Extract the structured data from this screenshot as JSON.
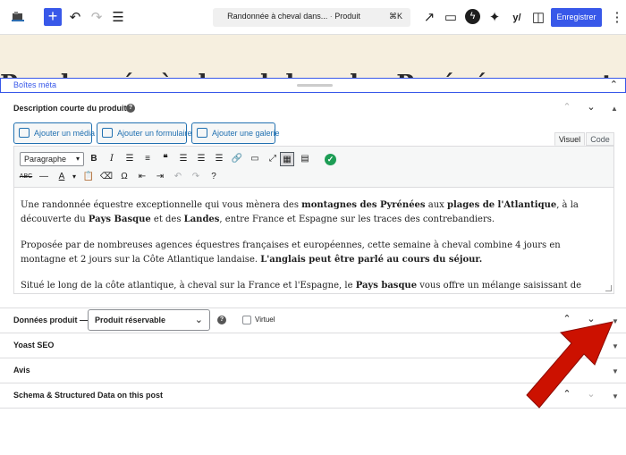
{
  "topbar": {
    "document_title": "Randonnée à cheval dans...",
    "document_separator": "·",
    "document_type": "Produit",
    "shortcut": "⌘K",
    "save_label": "Enregistrer"
  },
  "canvas": {
    "title_partial": "Randonnée à cheval dans les Pyrénées : montagne et la Pyrénées"
  },
  "meta_box": {
    "title": "Boîtes méta"
  },
  "short_description": {
    "title": "Description courte du produit",
    "buttons": {
      "add_media": "Ajouter un média",
      "add_form": "Ajouter un formulaire",
      "add_gallery": "Ajouter une galerie"
    },
    "tabs": {
      "visual": "Visuel",
      "code": "Code"
    },
    "format_select": "Paragraphe",
    "content": {
      "p1_a": "Une randonnée équestre exceptionnelle qui vous mènera des ",
      "p1_b": "montagnes des Pyrénées",
      "p1_c": " aux ",
      "p1_d": "plages de l'Atlantique",
      "p1_e": ", à la découverte du ",
      "p1_f": "Pays Basque",
      "p1_g": " et des ",
      "p1_h": "Landes",
      "p1_i": ", entre France et Espagne sur les traces des contrebandiers.",
      "p2_a": "Proposée par de nombreuses agences équestres françaises et européennes, cette semaine à cheval combine 4 jours en montagne et 2 jours sur la Côte Atlantique landaise. ",
      "p2_b": "L'anglais peut être parlé au cours du séjour.",
      "p3_a": "Situé le long de la côte atlantique, à cheval sur la France et l'Espagne, le ",
      "p3_b": "Pays basque",
      "p3_c": " vous offre un mélange saisissant de forêts luxuriantes, de collines verdoyantes, de plages et de montagnes escarpées. La région est réputée pour son climat doux..."
    }
  },
  "product_data": {
    "title": "Données produit —",
    "type_selected": "Produit réservable",
    "virtual_label": "Virtuel"
  },
  "panels": {
    "yoast": "Yoast SEO",
    "reviews": "Avis",
    "schema": "Schema & Structured Data on this post"
  },
  "colors": {
    "accent": "#3858e9",
    "canvas_bg": "#f6efdf",
    "arrow": "#cc1100",
    "link": "#2271b1"
  }
}
